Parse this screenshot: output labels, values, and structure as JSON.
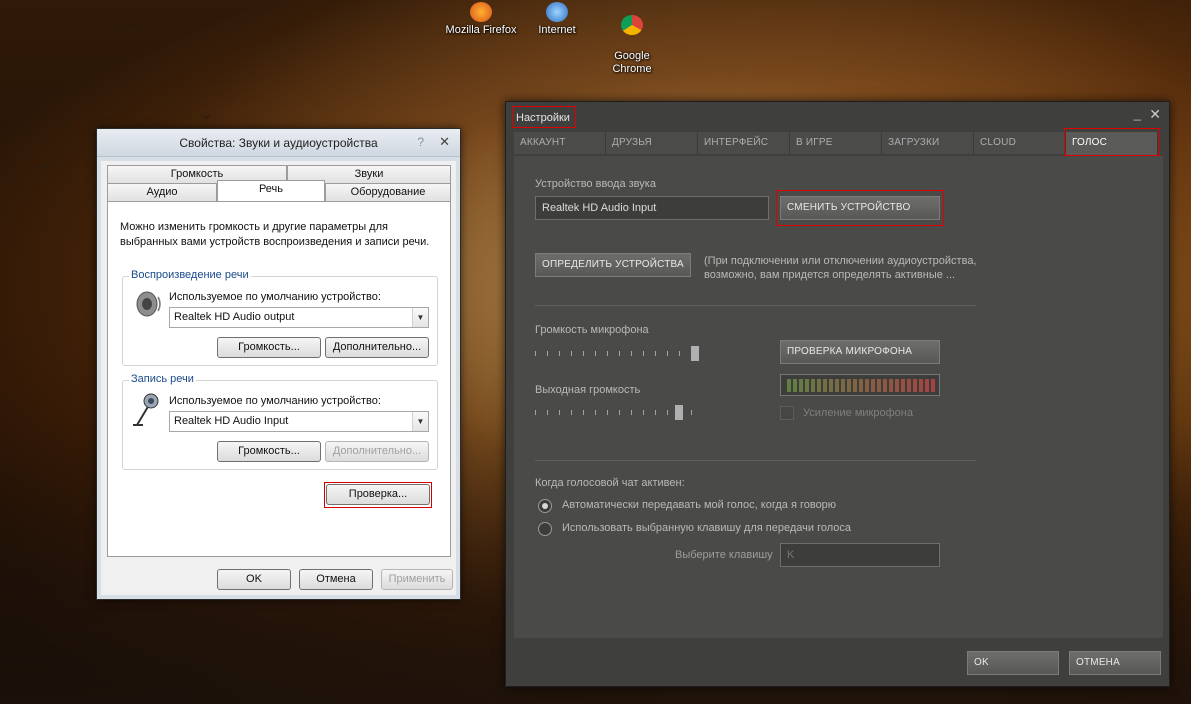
{
  "desktop": {
    "icons": [
      {
        "label": "Mozilla Firefox",
        "icon": "firefox-icon"
      },
      {
        "label": "Internet",
        "icon": "internet-icon"
      },
      {
        "label": "Google\nChrome",
        "icon": "chrome-icon"
      }
    ]
  },
  "sound_dialog": {
    "title": "Свойства: Звуки и аудиоустройства",
    "help": "?",
    "close": "✕",
    "tabs": {
      "volume": "Громкость",
      "sounds": "Звуки",
      "audio": "Аудио",
      "speech": "Речь",
      "hardware": "Оборудование"
    },
    "active_tab": "Речь",
    "description": "Можно изменить громкость и другие параметры для выбранных вами устройств воспроизведения и записи речи.",
    "playback": {
      "title": "Воспроизведение речи",
      "label": "Используемое по умолчанию устройство:",
      "device": "Realtek HD Audio output",
      "volume_button": "Громкость...",
      "advanced_button": "Дополнительно..."
    },
    "recording": {
      "title": "Запись речи",
      "label": "Используемое по умолчанию устройство:",
      "device": "Realtek HD Audio Input",
      "volume_button": "Громкость...",
      "advanced_button": "Дополнительно..."
    },
    "test_button": "Проверка...",
    "ok_button": "OK",
    "cancel_button": "Отмена",
    "apply_button": "Применить"
  },
  "steam": {
    "title": "Настройки",
    "minimize": "_",
    "close": "✕",
    "tabs": [
      "АККАУНТ",
      "ДРУЗЬЯ",
      "ИНТЕРФЕЙС",
      "В ИГРЕ",
      "ЗАГРУЗКИ",
      "CLOUD",
      "ГОЛОС"
    ],
    "active_tab": "ГОЛОС",
    "input_device_label": "Устройство ввода звука",
    "input_device": "Realtek HD Audio Input",
    "change_device_button": "СМЕНИТЬ УСТРОЙСТВО",
    "detect_devices_button": "ОПРЕДЕЛИТЬ УСТРОЙСТВА",
    "detect_hint": "(При подключении или отключении аудиоустройства,\nвозможно, вам придется определять активные ...",
    "mic_volume_label": "Громкость микрофона",
    "mic_volume": 1.0,
    "test_mic_button": "ПРОВЕРКА МИКРОФОНА",
    "output_volume_label": "Выходная громкость",
    "output_volume": 0.9,
    "mic_boost_label": "Усиление микрофона",
    "mic_boost_checked": false,
    "voice_active_label": "Когда голосовой чат активен:",
    "options": [
      {
        "label": "Автоматически передавать мой голос, когда я говорю",
        "selected": true
      },
      {
        "label": "Использовать выбранную клавишу для передачи голоса",
        "selected": false
      }
    ],
    "choose_key_label": "Выберите клавишу",
    "key_value": "K",
    "ok_button": "OK",
    "cancel_button": "ОТМЕНА"
  }
}
